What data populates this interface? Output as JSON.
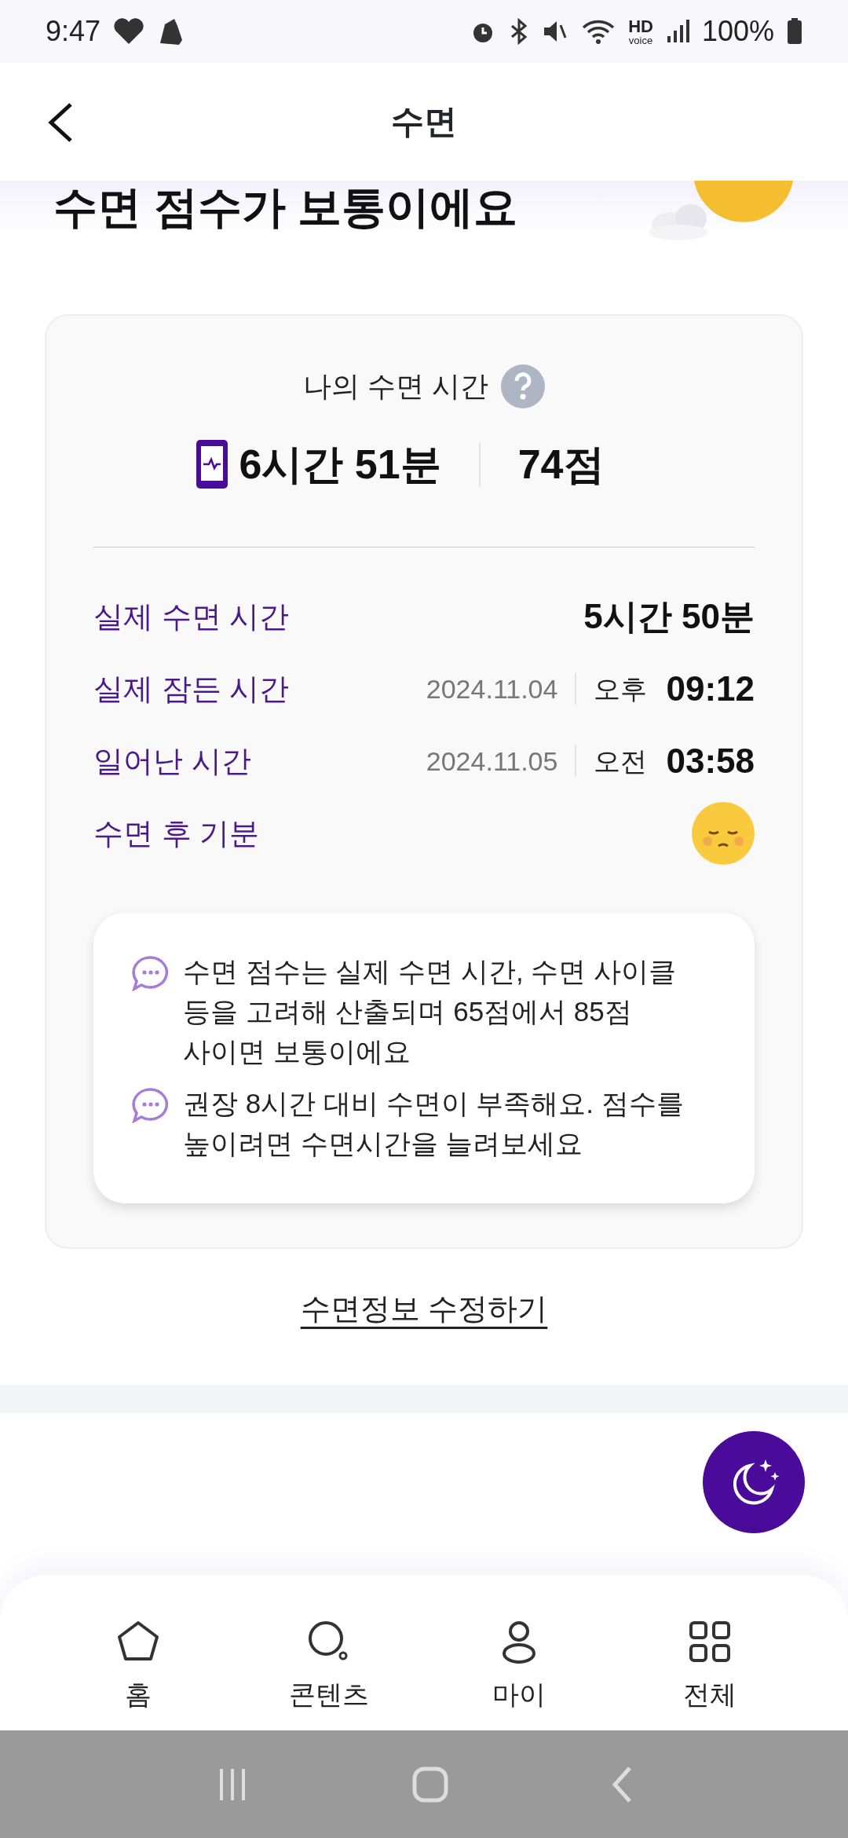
{
  "status_bar": {
    "time": "9:47",
    "hd": "HD",
    "voice": "voice",
    "battery": "100%"
  },
  "header": {
    "title": "수면"
  },
  "headline": "수면 점수가 보통이에요",
  "summary": {
    "title": "나의 수면 시간",
    "duration": "6시간 51분",
    "score": "74점"
  },
  "details": [
    {
      "kind": "value",
      "label": "실제 수면 시간",
      "value": "5시간 50분"
    },
    {
      "kind": "datetime",
      "label": "실제 잠든 시간",
      "date": "2024.11.04",
      "period": "오후",
      "time": "09:12"
    },
    {
      "kind": "datetime",
      "label": "일어난 시간",
      "date": "2024.11.05",
      "period": "오전",
      "time": "03:58"
    },
    {
      "kind": "mood",
      "label": "수면 후 기분"
    }
  ],
  "notes": [
    "수면 점수는 실제 수면 시간, 수면 사이클 등을 고려해 산출되며 65점에서 85점 사이면 보통이에요",
    "권장 8시간 대비 수면이 부족해요. 점수를 높이려면 수면시간을 늘려보세요"
  ],
  "edit_link": "수면정보 수정하기",
  "nav": [
    {
      "kind": "home",
      "label": "홈"
    },
    {
      "kind": "content",
      "label": "콘텐츠"
    },
    {
      "kind": "my",
      "label": "마이"
    },
    {
      "kind": "all",
      "label": "전체"
    }
  ]
}
